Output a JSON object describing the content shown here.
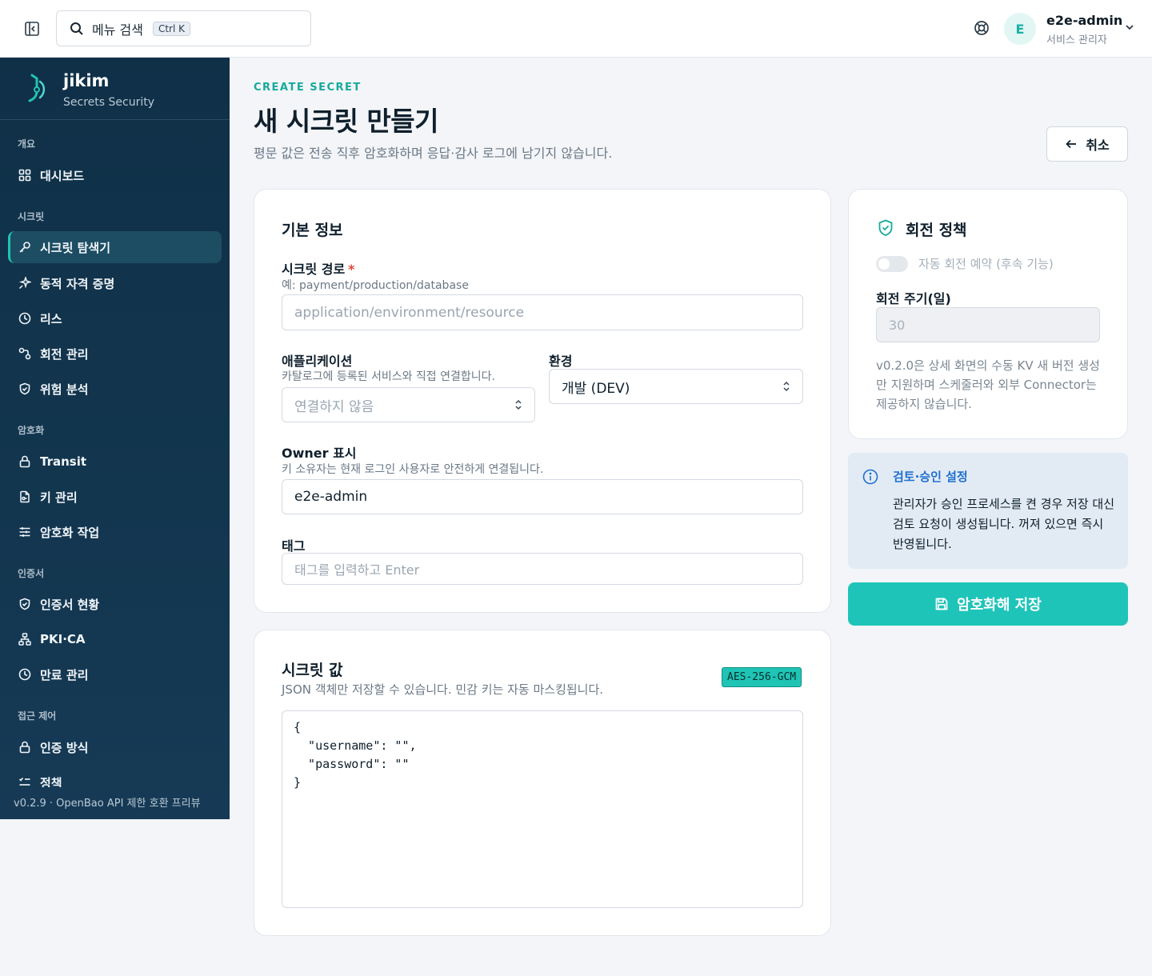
{
  "topbar": {
    "search_label": "메뉴 검색",
    "search_shortcut": "Ctrl K",
    "user_initial": "E",
    "user_name": "e2e-admin",
    "user_role": "서비스 관리자"
  },
  "brand": {
    "name": "jikim",
    "subtitle": "Secrets Security"
  },
  "sidebar": {
    "sections": [
      {
        "label": "개요",
        "items": [
          {
            "label": "대시보드",
            "icon": "grid-icon"
          }
        ]
      },
      {
        "label": "시크릿",
        "items": [
          {
            "label": "시크릿 탐색기",
            "icon": "key-icon",
            "active": true
          },
          {
            "label": "동적 자격 증명",
            "icon": "sparkle-icon"
          },
          {
            "label": "리스",
            "icon": "clock-icon"
          },
          {
            "label": "회전 관리",
            "icon": "rotate-icon"
          },
          {
            "label": "위험 분석",
            "icon": "shield-icon"
          }
        ]
      },
      {
        "label": "암호화",
        "items": [
          {
            "label": "Transit",
            "icon": "lock-icon"
          },
          {
            "label": "키 관리",
            "icon": "file-key-icon"
          },
          {
            "label": "암호화 작업",
            "icon": "sliders-icon"
          }
        ]
      },
      {
        "label": "인증서",
        "items": [
          {
            "label": "인증서 현황",
            "icon": "shield-check-icon"
          },
          {
            "label": "PKI·CA",
            "icon": "network-icon"
          },
          {
            "label": "만료 관리",
            "icon": "clock-icon"
          }
        ]
      },
      {
        "label": "접근 제어",
        "items": [
          {
            "label": "인증 방식",
            "icon": "lock-icon"
          },
          {
            "label": "정책",
            "icon": "list-check-icon"
          }
        ]
      }
    ],
    "footer": "v0.2.9 · OpenBao API 제한 호환 프리뷰"
  },
  "page": {
    "eyebrow": "CREATE SECRET",
    "title": "새 시크릿 만들기",
    "description": "평문 값은 전송 직후 암호화하며 응답·감사 로그에 남기지 않습니다.",
    "cancel_label": "취소"
  },
  "basic_info": {
    "title": "기본 정보",
    "path_label": "시크릿 경로",
    "path_required": "*",
    "path_help": "예: payment/production/database",
    "path_placeholder": "application/environment/resource",
    "app_label": "애플리케이션",
    "app_help": "카탈로그에 등록된 서비스와 직접 연결합니다.",
    "app_value": "연결하지 않음",
    "env_label": "환경",
    "env_value": "개발 (DEV)",
    "owner_label": "Owner 표시",
    "owner_help": "키 소유자는 현재 로그인 사용자로 안전하게 연결됩니다.",
    "owner_value": "e2e-admin",
    "tag_label": "태그",
    "tag_placeholder": "태그를 입력하고 Enter"
  },
  "secret_value": {
    "title": "시크릿 값",
    "help": "JSON 객체만 저장할 수 있습니다. 민감 키는 자동 마스킹됩니다.",
    "badge": "AES-256-GCM",
    "json_text": "{\n  \"username\": \"\",\n  \"password\": \"\"\n}"
  },
  "rotation": {
    "title": "회전 정책",
    "toggle_label": "자동 회전 예약 (후속 기능)",
    "toggle_on": false,
    "period_label": "회전 주기(일)",
    "period_value": "30",
    "note": "v0.2.0은 상세 화면의 수동 KV 새 버전 생성만 지원하며 스케줄러와 외부 Connector는 제공하지 않습니다."
  },
  "review": {
    "title": "검토·승인 설정",
    "text": "관리자가 승인 프로세스를 켠 경우 저장 대신 검토 요청이 생성됩니다. 꺼져 있으면 즉시 반영됩니다."
  },
  "save_label": "암호화해 저장",
  "colors": {
    "accent": "#1fc4b9",
    "sidebar_bg": "#0f3047",
    "info_blue": "#1f6fd0"
  }
}
